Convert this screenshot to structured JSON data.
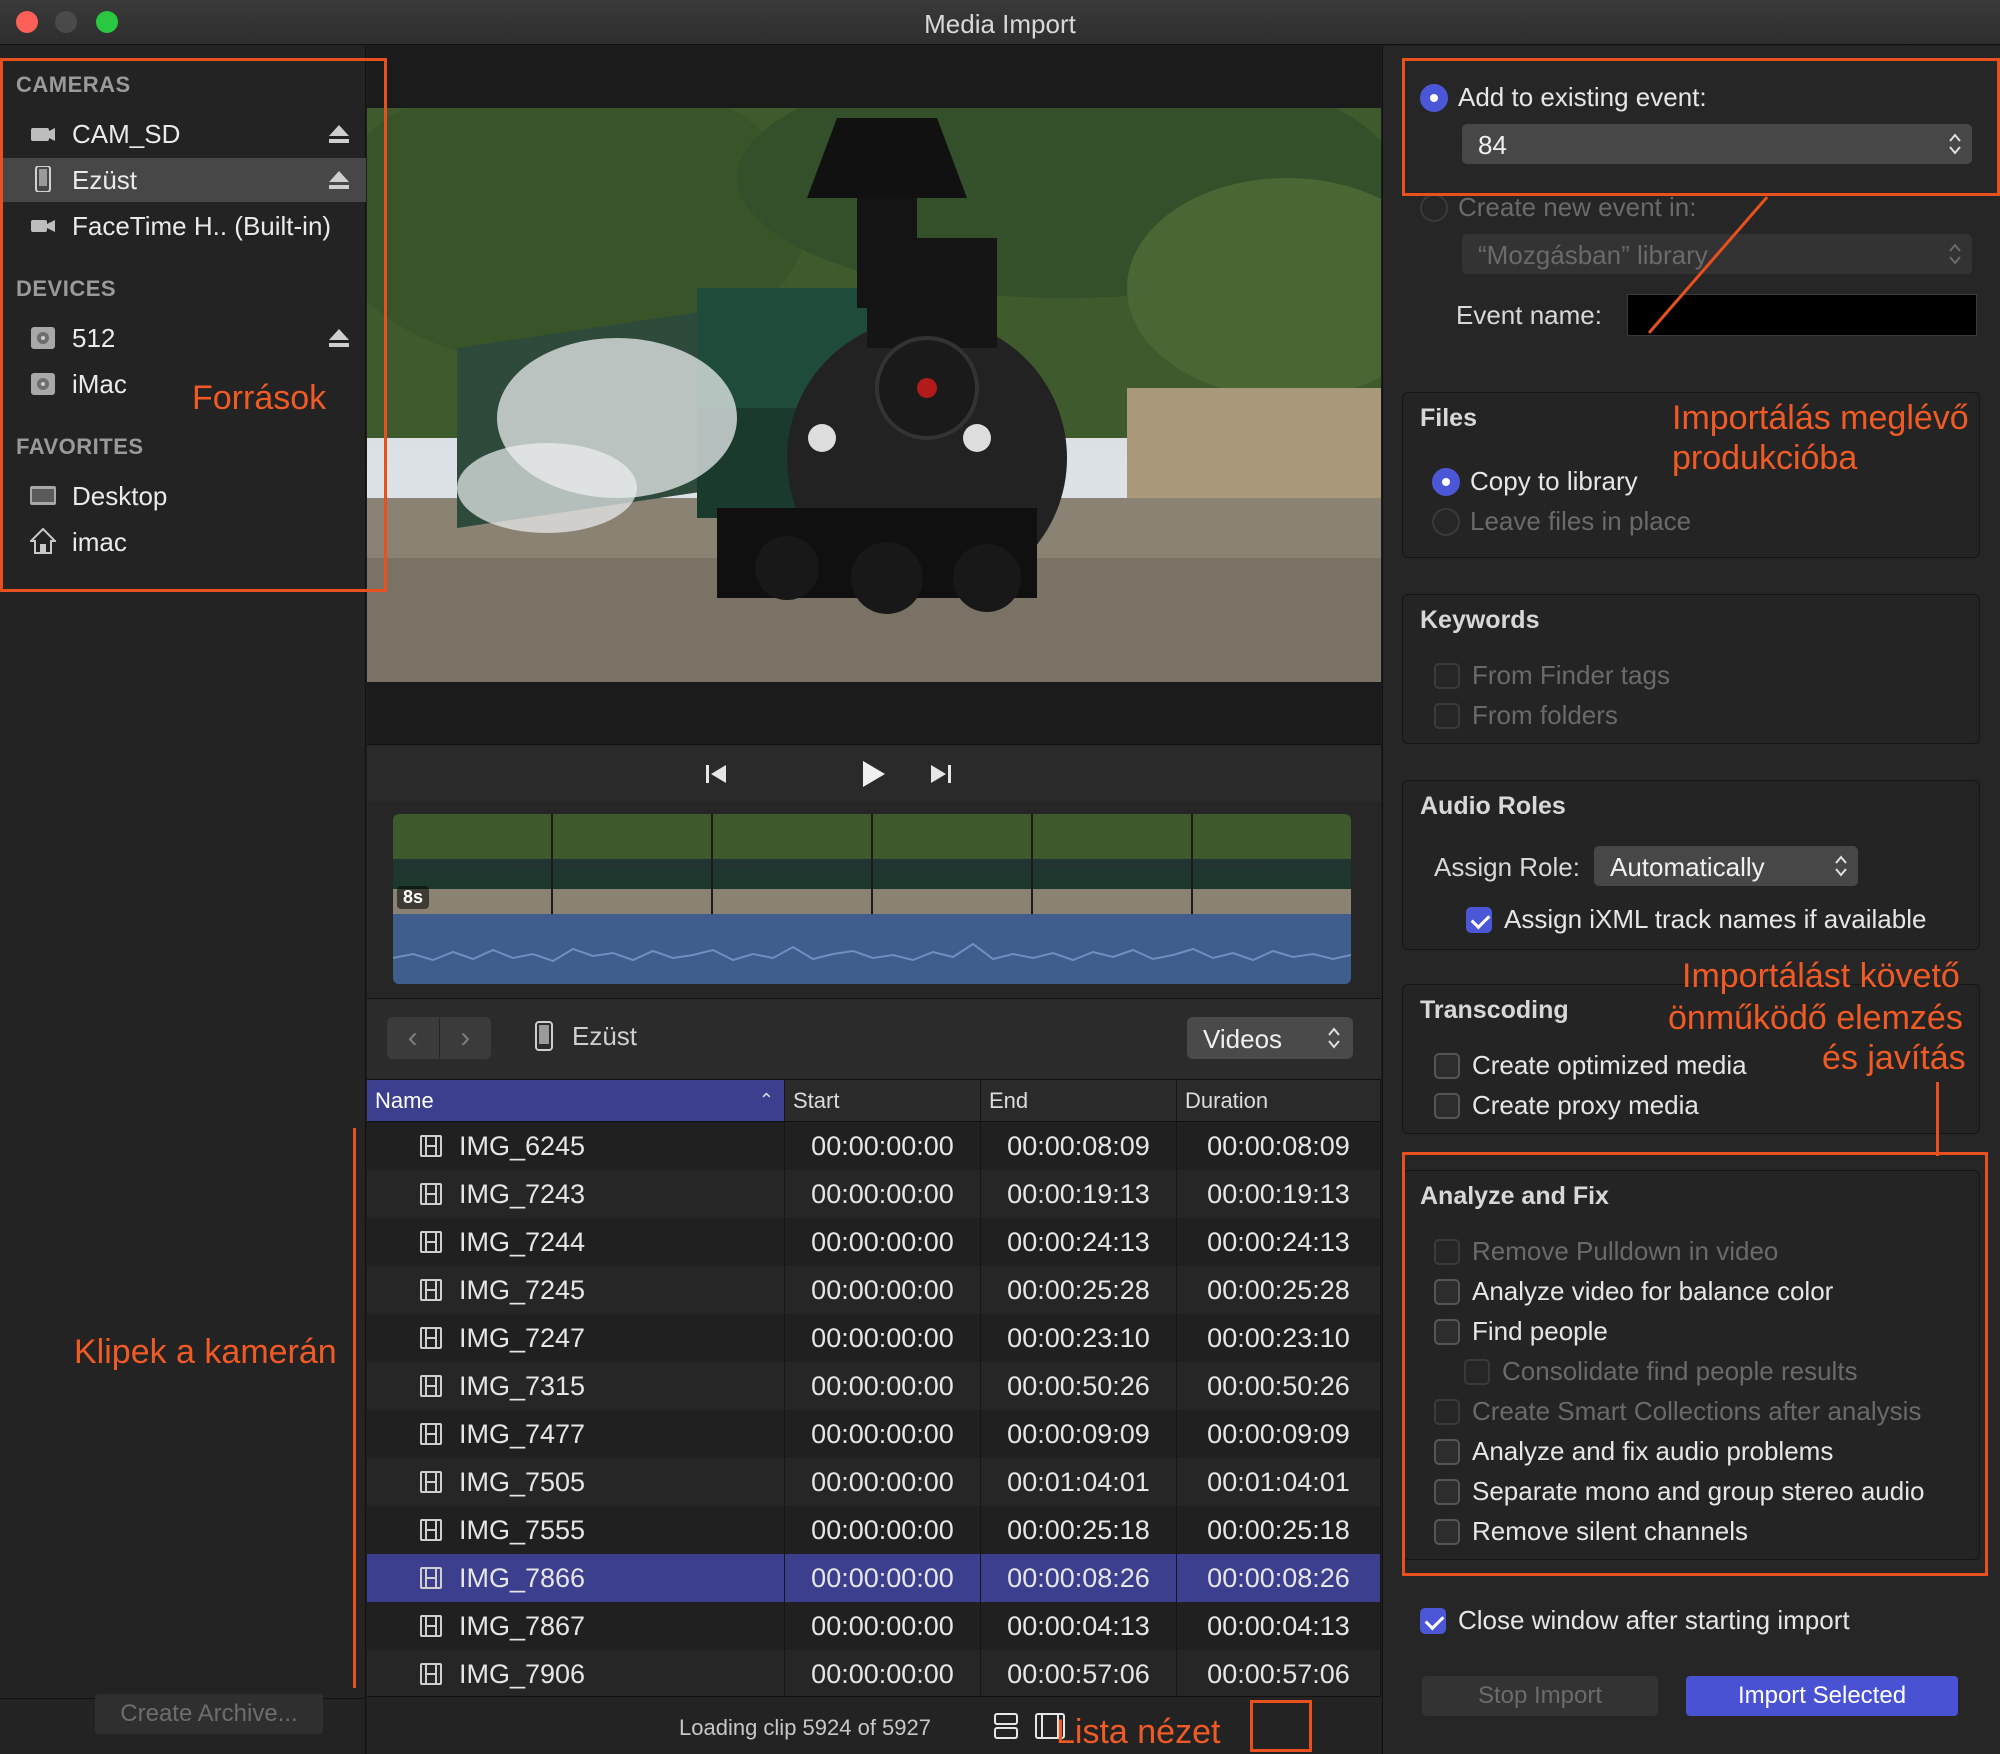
{
  "window": {
    "title": "Media Import"
  },
  "sidebar": {
    "cameras_header": "CAMERAS",
    "cameras": [
      {
        "label": "CAM_SD",
        "icon": "camcorder-icon",
        "ejectable": true,
        "selected": false
      },
      {
        "label": "Ezüst",
        "icon": "iphone-icon",
        "ejectable": true,
        "selected": true
      },
      {
        "label": "FaceTime H.. (Built-in)",
        "icon": "video-camera-icon",
        "ejectable": false,
        "selected": false
      }
    ],
    "devices_header": "DEVICES",
    "devices": [
      {
        "label": "512",
        "icon": "drive-icon",
        "ejectable": true
      },
      {
        "label": "iMac",
        "icon": "drive-icon",
        "ejectable": false
      }
    ],
    "favorites_header": "FAVORITES",
    "favorites": [
      {
        "label": "Desktop",
        "icon": "desktop-icon"
      },
      {
        "label": "imac",
        "icon": "home-icon"
      }
    ],
    "create_archive": "Create Archive..."
  },
  "filmstrip": {
    "duration_badge": "8s"
  },
  "browser": {
    "back": "‹",
    "forward": "›",
    "source_name": "Ezüst",
    "filter": "Videos",
    "columns": {
      "name": "Name",
      "start": "Start",
      "end": "End",
      "duration": "Duration"
    },
    "clips": [
      {
        "name": "IMG_6245",
        "start": "00:00:00:00",
        "end": "00:00:08:09",
        "duration": "00:00:08:09"
      },
      {
        "name": "IMG_7243",
        "start": "00:00:00:00",
        "end": "00:00:19:13",
        "duration": "00:00:19:13"
      },
      {
        "name": "IMG_7244",
        "start": "00:00:00:00",
        "end": "00:00:24:13",
        "duration": "00:00:24:13"
      },
      {
        "name": "IMG_7245",
        "start": "00:00:00:00",
        "end": "00:00:25:28",
        "duration": "00:00:25:28"
      },
      {
        "name": "IMG_7247",
        "start": "00:00:00:00",
        "end": "00:00:23:10",
        "duration": "00:00:23:10"
      },
      {
        "name": "IMG_7315",
        "start": "00:00:00:00",
        "end": "00:00:50:26",
        "duration": "00:00:50:26"
      },
      {
        "name": "IMG_7477",
        "start": "00:00:00:00",
        "end": "00:00:09:09",
        "duration": "00:00:09:09"
      },
      {
        "name": "IMG_7505",
        "start": "00:00:00:00",
        "end": "00:01:04:01",
        "duration": "00:01:04:01"
      },
      {
        "name": "IMG_7555",
        "start": "00:00:00:00",
        "end": "00:00:25:18",
        "duration": "00:00:25:18"
      },
      {
        "name": "IMG_7866",
        "start": "00:00:00:00",
        "end": "00:00:08:26",
        "duration": "00:00:08:26",
        "selected": true
      },
      {
        "name": "IMG_7867",
        "start": "00:00:00:00",
        "end": "00:00:04:13",
        "duration": "00:00:04:13"
      },
      {
        "name": "IMG_7906",
        "start": "00:00:00:00",
        "end": "00:00:57:06",
        "duration": "00:00:57:06"
      }
    ],
    "status": "Loading clip 5924 of 5927"
  },
  "import_options": {
    "add_existing": "Add to existing event:",
    "existing_event": "84",
    "create_new": "Create new event in:",
    "library": "“Mozgásban” library",
    "event_name_label": "Event name:",
    "files_title": "Files",
    "copy_to_library": "Copy to library",
    "leave_in_place": "Leave files in place",
    "keywords_title": "Keywords",
    "from_finder_tags": "From Finder tags",
    "from_folders": "From folders",
    "audio_title": "Audio Roles",
    "assign_role_label": "Assign Role:",
    "assign_role_value": "Automatically",
    "assign_ixml": "Assign iXML track names if available",
    "transcoding_title": "Transcoding",
    "optimized": "Create optimized media",
    "proxy": "Create proxy media",
    "analyze_title": "Analyze and Fix",
    "remove_pulldown": "Remove Pulldown in video",
    "balance_color": "Analyze video for balance color",
    "find_people": "Find people",
    "consolidate": "Consolidate find people results",
    "smart_collections": "Create Smart Collections after analysis",
    "audio_problems": "Analyze and fix audio problems",
    "mono_stereo": "Separate mono and group stereo audio",
    "silent_channels": "Remove silent channels",
    "close_window": "Close window after starting import",
    "stop_import": "Stop Import",
    "import_selected": "Import Selected"
  },
  "annotations": {
    "sources": "Források",
    "import_existing_line1": "Importálás meglévő",
    "import_existing_line2": "produkcióba",
    "auto_analysis_line1": "Importálást követő",
    "auto_analysis_line2": "önműködő elemzés",
    "auto_analysis_line3": "és javítás",
    "clips_on_camera": "Klipek a kamerán",
    "list_view": "Lista nézet"
  },
  "colors": {
    "accent": "#4b57d6",
    "annotation": "#e8501e",
    "selection": "#3b3f8e"
  }
}
